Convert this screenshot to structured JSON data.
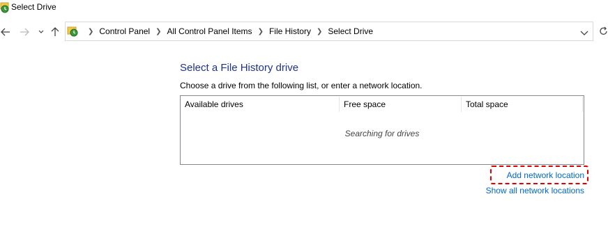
{
  "window": {
    "title": "Select Drive"
  },
  "navigation": {
    "back_icon": "arrow-left-icon",
    "forward_icon": "arrow-right-icon",
    "recent_icon": "chevron-down-icon",
    "up_icon": "arrow-up-icon",
    "refresh_icon": "refresh-icon"
  },
  "breadcrumb": {
    "items": [
      "Control Panel",
      "All Control Panel Items",
      "File History",
      "Select Drive"
    ]
  },
  "main": {
    "heading": "Select a File History drive",
    "instructions": "Choose a drive from the following list, or enter a network location.",
    "columns": [
      "Available drives",
      "Free space",
      "Total space"
    ],
    "status_text": "Searching for drives"
  },
  "links": {
    "add_network": "Add network location",
    "show_all_network": "Show all network locations"
  },
  "colors": {
    "heading": "#1e3287",
    "link": "#0066cc",
    "highlight": "#e00000"
  }
}
